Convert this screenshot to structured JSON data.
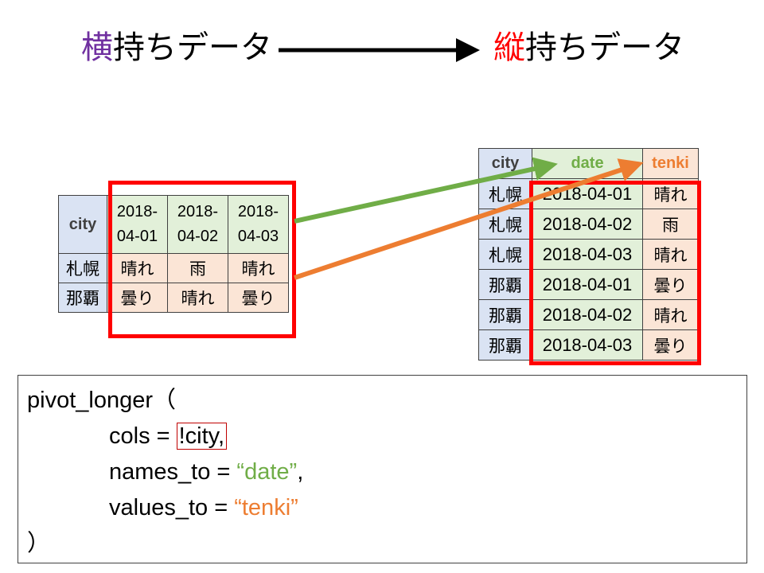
{
  "title": {
    "left_accent": "横",
    "left_rest": "持ちデータ",
    "right_accent": "縦",
    "right_rest": "持ちデータ"
  },
  "wide_table": {
    "header_city": "city",
    "dates": [
      [
        "2018-",
        "04-01"
      ],
      [
        "2018-",
        "04-02"
      ],
      [
        "2018-",
        "04-03"
      ]
    ],
    "rows": [
      {
        "city": "札幌",
        "values": [
          "晴れ",
          "雨",
          "晴れ"
        ]
      },
      {
        "city": "那覇",
        "values": [
          "曇り",
          "晴れ",
          "曇り"
        ]
      }
    ]
  },
  "long_table": {
    "headers": [
      "city",
      "date",
      "tenki"
    ],
    "rows": [
      [
        "札幌",
        "2018-04-01",
        "晴れ"
      ],
      [
        "札幌",
        "2018-04-02",
        "雨"
      ],
      [
        "札幌",
        "2018-04-03",
        "晴れ"
      ],
      [
        "那覇",
        "2018-04-01",
        "曇り"
      ],
      [
        "那覇",
        "2018-04-02",
        "晴れ"
      ],
      [
        "那覇",
        "2018-04-03",
        "曇り"
      ]
    ]
  },
  "code": {
    "line1": "pivot_longer（",
    "cols_label": "cols = ",
    "cols_value": "!city,",
    "names_label": "names_to = ",
    "names_q_open": "“",
    "names_value": "date",
    "names_q_close": "”",
    "names_comma": ",",
    "values_label": "values_to = ",
    "values_q_open": "“",
    "values_value": "tenki",
    "values_q_close": "”",
    "close": "）"
  },
  "colors": {
    "green": "#70ad47",
    "orange": "#ed7d31",
    "red": "#ff0000",
    "purple": "#7030a0"
  }
}
